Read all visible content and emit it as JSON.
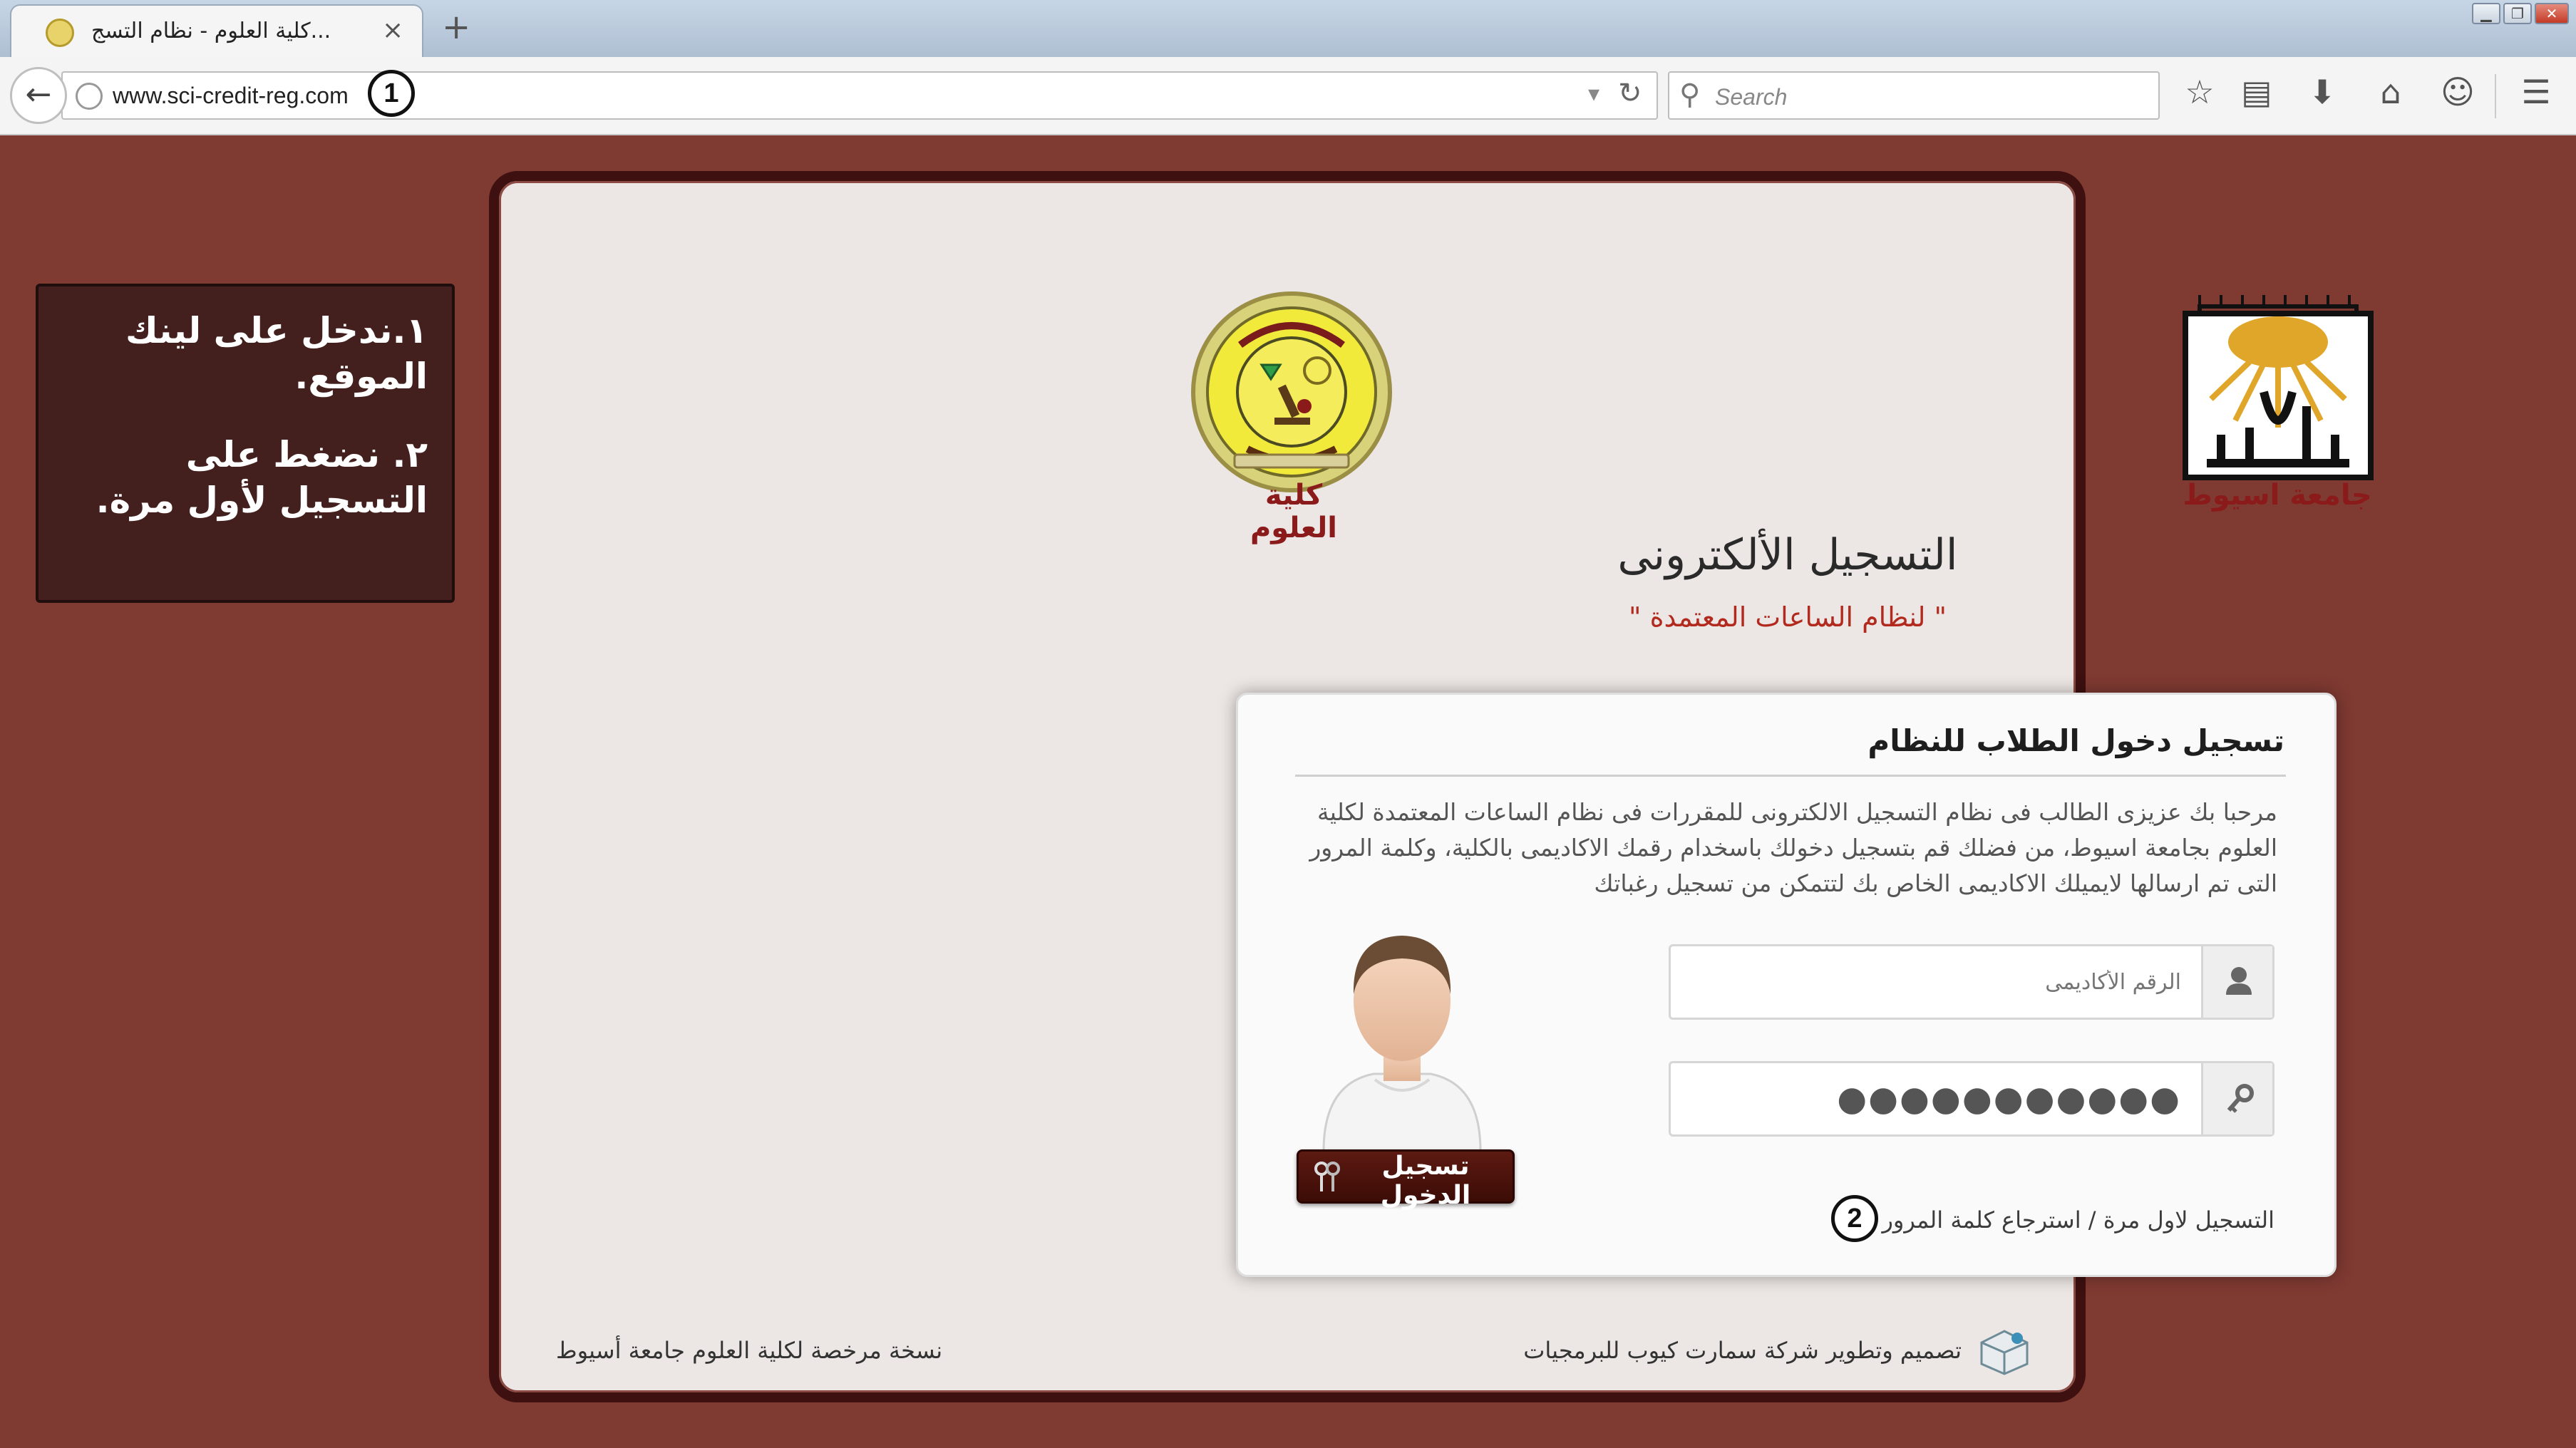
{
  "browser": {
    "tab_title": "كلية العلوم - نظام التسج...",
    "tab_close": "×",
    "new_tab": "+",
    "url": "www.sci-credit-reg.com",
    "search_placeholder": "Search",
    "window_controls": [
      "▁",
      "❐",
      "✕"
    ]
  },
  "steps": {
    "step1": "1",
    "step2": "2"
  },
  "instructions": {
    "line1": "١.ندخل على لينك الموقع.",
    "line2": "٢. نضغط على التسجيل لأول مرة."
  },
  "logos": {
    "science_label": "كلية العلوم",
    "university_label": "جامعة اسيوط"
  },
  "page": {
    "title": "التسجيل الألكترونى",
    "subtitle": "\" لنظام الساعات المعتمدة \""
  },
  "login": {
    "heading": "تسجيل دخول الطلاب للنظام",
    "welcome": "مرحبا بك عزيزى الطالب فى نظام التسجيل الالكترونى للمقررات فى نظام الساعات المعتمدة لكلية العلوم بجامعة اسيوط، من فضلك قم بتسجيل دخولك باسخدام رقمك الاكاديمى بالكلية، وكلمة المرور التى تم ارسالها لايميلك الاكاديمى الخاص بك لتتمكن من تسجيل رغباتك",
    "academic_id_placeholder": "الرقم الأكاديمى",
    "password_masked": "●●●●●●●●●●●",
    "login_button": "تسجيل الدخول",
    "first_time_link": "التسجيل لاول مرة",
    "separator": "/",
    "recover_link": "استرجاع كلمة المرور"
  },
  "footer": {
    "developer": "تصميم وتطوير شركة سمارت كيوب للبرمجيات",
    "license": "نسخة مرخصة لكلية العلوم جامعة أسيوط"
  },
  "colors": {
    "page_background": "#7f3a32",
    "card_background": "#ece6e4",
    "card_border": "#3e1010",
    "accent_red": "#8b1a1a",
    "instruction_box": "#43201d"
  }
}
